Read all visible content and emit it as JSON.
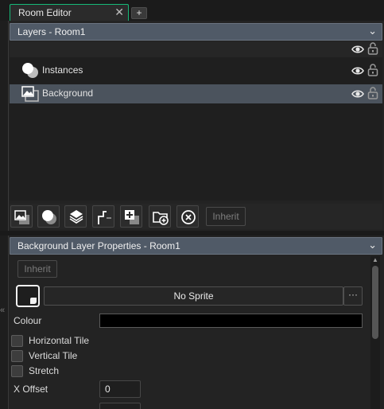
{
  "tab": {
    "label": "Room Editor",
    "close": "✕",
    "add": "+"
  },
  "layers_panel": {
    "title": "Layers - Room1",
    "items": [
      {
        "label": "Instances",
        "icon": "instances-layer-icon",
        "selected": false
      },
      {
        "label": "Background",
        "icon": "background-layer-icon",
        "selected": true
      }
    ]
  },
  "toolbar": {
    "buttons": [
      "add-background-layer",
      "add-instance-layer",
      "add-tile-layer",
      "add-path-layer",
      "add-asset-layer",
      "add-folder",
      "delete-layer"
    ],
    "inherit_label": "Inherit"
  },
  "properties": {
    "title": "Background Layer Properties - Room1",
    "inherit_label": "Inherit",
    "sprite_value": "No Sprite",
    "sprite_more": "···",
    "colour_label": "Colour",
    "colour_value": "#000000",
    "horizontal_tile": "Horizontal Tile",
    "vertical_tile": "Vertical Tile",
    "stretch": "Stretch",
    "x_offset_label": "X Offset",
    "x_offset_value": "0"
  },
  "colors": {
    "accent_tab": "#16b978",
    "header_bg": "#505a67",
    "selected_row": "#4b535d"
  }
}
